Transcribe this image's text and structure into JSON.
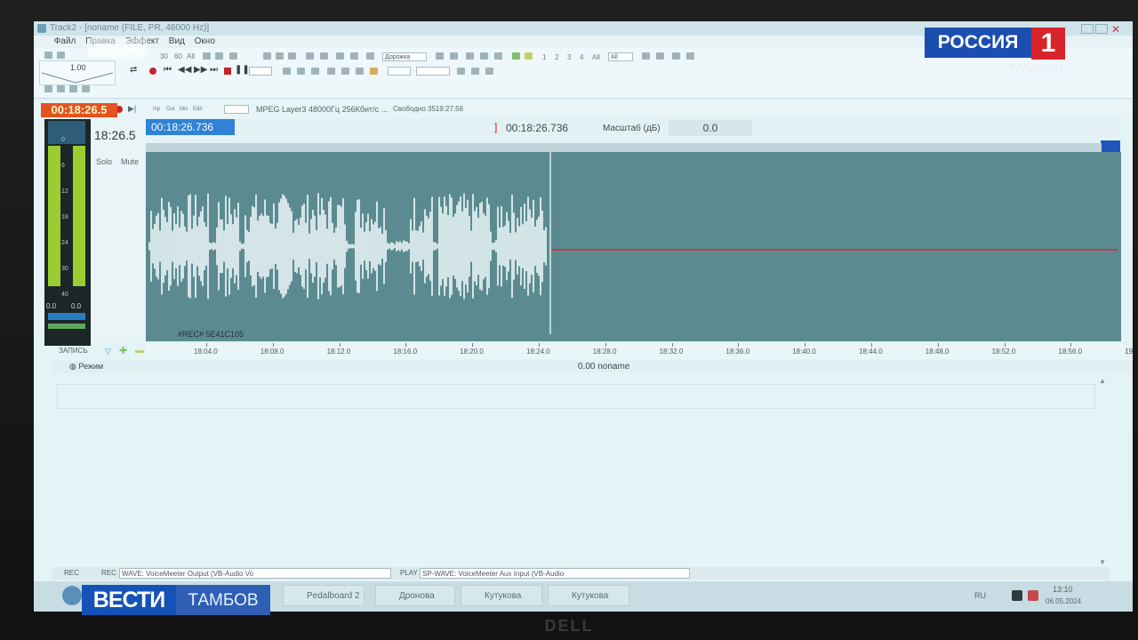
{
  "app": {
    "title": "Track2 - [noname (FILE, PR, 48000 Hz)]",
    "menu": [
      "Файл",
      "Правка",
      "Эффект",
      "Вид",
      "Окно"
    ]
  },
  "toolbar": {
    "counter_1": "1.00",
    "zoom_vals": [
      "30",
      "60",
      "All"
    ],
    "dropdown_track": "Дорожка",
    "track_nums": [
      "1",
      "2",
      "3",
      "4",
      "All"
    ],
    "dropdown_all": "All"
  },
  "status": {
    "time_main": "00:18:26.5",
    "format": "MPEG Layer3 48000Гц 256Кбит/с ...",
    "free_label": "Свободно 3519:27.56",
    "small_labels": [
      "Inp",
      "Out",
      "Mix",
      "Edit"
    ]
  },
  "track": {
    "time_short": "18:26.5",
    "time_long": "00:18:26.736",
    "solo": "Solo",
    "mute": "Mute",
    "cursor_time": "00:18:26.736",
    "scale_label": "Масштаб (дБ)",
    "scale_value": "0.0",
    "rec_label": "#REC# 5E41C105",
    "meter_scale": [
      "0",
      "6",
      "12",
      "18",
      "24",
      "30",
      "40"
    ],
    "meter_bottom": [
      "0.0",
      "0.0"
    ],
    "zapis": "ЗАПИСЬ"
  },
  "ruler": {
    "ticks": [
      "18:04.0",
      "18:08.0",
      "18:12.0",
      "18:16.0",
      "18:20.0",
      "18:24.0",
      "18:28.0",
      "18:32.0",
      "18:36.0",
      "18:40.0",
      "18:44.0",
      "18:48.0",
      "18:52.0",
      "18:56.0",
      "19"
    ]
  },
  "mode": {
    "label": "Режим",
    "info": "0.00  noname"
  },
  "devices": {
    "rec_label": "REC",
    "rec_small": "REC",
    "rec_device": "WAVE: VoiceMeeter Output (VB-Audio Vo",
    "play_label": "PLAY",
    "play_device": "SP-WAVE: VoiceMeeter Aux Input (VB-Audio"
  },
  "taskbar": {
    "items": [
      "Pedalboard 2",
      "Дронова",
      "Кутукова",
      "Кутукова"
    ],
    "lang": "RU",
    "clock_time": "13:10",
    "clock_date": "06.05.2024"
  },
  "overlay": {
    "dosye": "ДОСЬЕ",
    "russia": "РОССИЯ",
    "russia_one": "1",
    "russia_tambov": "ТАМБОВ",
    "vesti": "ВЕСТИ",
    "vesti_tambov": "ТАМБОВ"
  },
  "monitor_brand": "DELL",
  "colors": {
    "waveform_bg": "#5b8b91",
    "waveform": "#f2fbfd",
    "playhead_line": "#cf2a3c",
    "time_box": "#e3521f",
    "vesti_blue": "#1452b7",
    "russia_red": "#d8232a"
  }
}
